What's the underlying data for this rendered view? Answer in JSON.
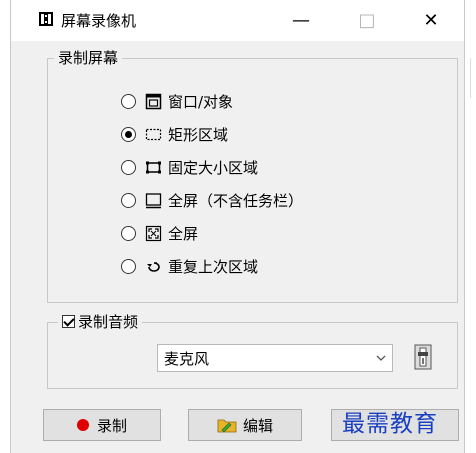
{
  "window": {
    "title": "屏幕录像机",
    "controls": {
      "minimize": "—",
      "maximize": "□",
      "close": "✕"
    }
  },
  "record_screen": {
    "label": "录制屏幕",
    "options": [
      {
        "label": "窗口/对象",
        "icon": "window-icon",
        "selected": false
      },
      {
        "label": "矩形区域",
        "icon": "rectangle-select-icon",
        "selected": true
      },
      {
        "label": "固定大小区域",
        "icon": "fixed-size-icon",
        "selected": false
      },
      {
        "label": "全屏（不含任务栏）",
        "icon": "fullscreen-no-taskbar-icon",
        "selected": false
      },
      {
        "label": "全屏",
        "icon": "fullscreen-icon",
        "selected": false
      },
      {
        "label": "重复上次区域",
        "icon": "repeat-icon",
        "selected": false
      }
    ]
  },
  "record_audio": {
    "label": "录制音频",
    "checked": true,
    "device": "麦克风"
  },
  "buttons": {
    "record": "录制",
    "edit": "编辑"
  },
  "watermark": "最需教育",
  "colors": {
    "record_dot": "#e00000",
    "watermark": "#1a3fbf"
  }
}
